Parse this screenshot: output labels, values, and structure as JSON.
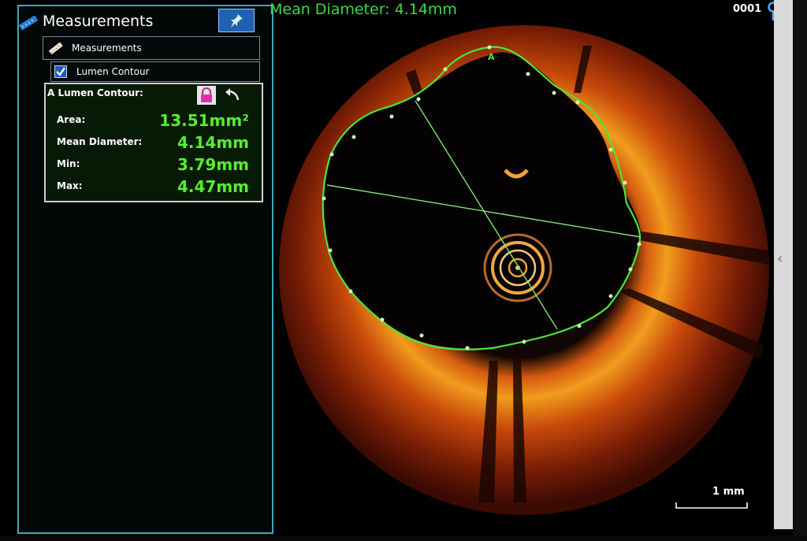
{
  "panel": {
    "title": "Measurements",
    "measurements_item": "Measurements",
    "contour_item": "Lumen Contour",
    "result": {
      "title": "A Lumen Contour:",
      "rows": [
        {
          "label": "Area:",
          "value": "13.51mm²"
        },
        {
          "label": "Mean Diameter:",
          "value": "4.14mm"
        },
        {
          "label": "Min:",
          "value": "3.79mm"
        },
        {
          "label": "Max:",
          "value": "4.47mm"
        }
      ]
    }
  },
  "image": {
    "header": "Mean Diameter:  4.14mm",
    "frame": "0001",
    "contour_label": "A",
    "scale_label": "1 mm"
  },
  "colors": {
    "accent": "#3ea7b9",
    "measurement_green": "#56ee30",
    "contour_green": "#4ee43a"
  },
  "icons": [
    "ruler-icon",
    "pin-icon",
    "lock-icon",
    "undo-icon",
    "checkbox-icon",
    "frame-marker-icon",
    "chevron-left-icon"
  ]
}
